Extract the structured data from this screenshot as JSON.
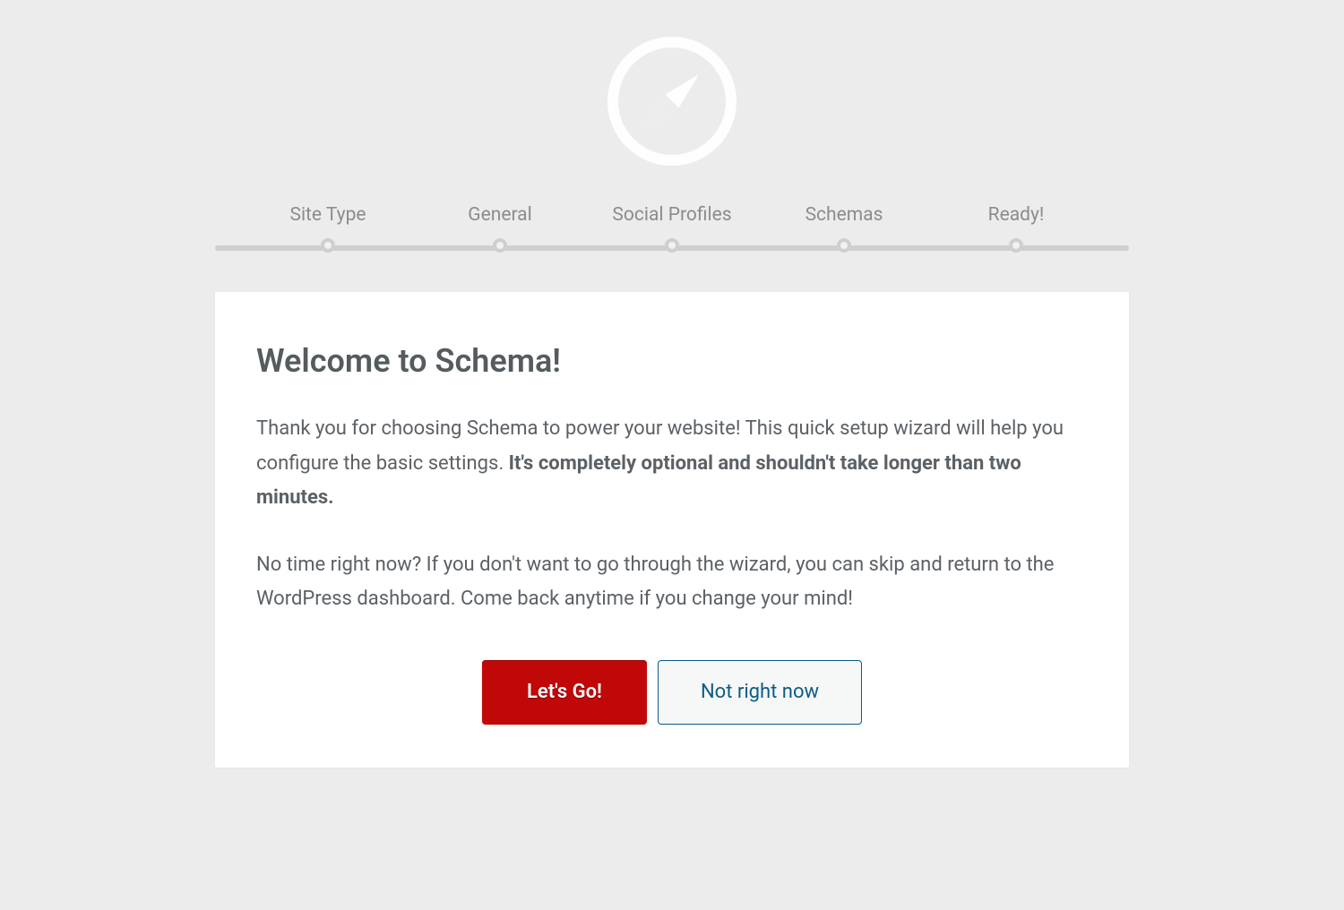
{
  "steps": [
    {
      "label": "Site Type"
    },
    {
      "label": "General"
    },
    {
      "label": "Social Profiles"
    },
    {
      "label": "Schemas"
    },
    {
      "label": "Ready!"
    }
  ],
  "content": {
    "heading": "Welcome to Schema!",
    "intro_plain": "Thank you for choosing Schema to power your website! This quick setup wizard will help you configure the basic settings. ",
    "intro_bold": "It's completely optional and shouldn't take longer than two minutes.",
    "skip_text": "No time right now? If you don't want to go through the wizard, you can skip and return to the WordPress dashboard. Come back anytime if you change your mind!"
  },
  "actions": {
    "primary": "Let's Go!",
    "secondary": "Not right now"
  }
}
